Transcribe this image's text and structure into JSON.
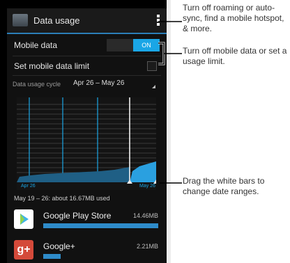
{
  "app": {
    "title": "Data usage",
    "icon": "settings-icon",
    "menu_icon": "overflow-menu-icon"
  },
  "settings": {
    "mobile_data_label": "Mobile data",
    "toggle_state": "ON",
    "limit_label": "Set mobile data limit",
    "cycle_label": "Data usage cycle",
    "cycle_value": "Apr 26 – May 26"
  },
  "chart": {
    "start_label": "Apr 26",
    "end_label": "May 26"
  },
  "summary": "May 19 – 26: about 16.67MB used",
  "apps": [
    {
      "name": "Google Play Store",
      "size": "14.46MB",
      "icon": "play-store-icon",
      "usage_fraction": 1.0
    },
    {
      "name": "Google+",
      "size": "2.21MB",
      "icon": "google-plus-icon",
      "usage_fraction": 0.15
    }
  ],
  "callouts": {
    "top": "Turn off roaming or auto-sync, find a mobile hotspot, & more.",
    "middle": "Turn off mobile data or set a usage limit.",
    "bottom": "Drag the white bars to change date ranges."
  },
  "colors": {
    "accent": "#1aa6e6",
    "background": "#111111"
  }
}
